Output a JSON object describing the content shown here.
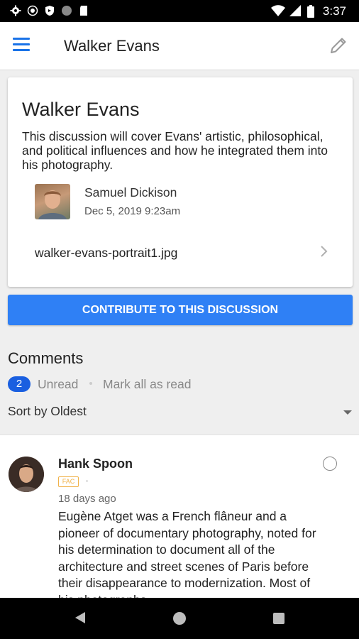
{
  "status_bar": {
    "time": "3:37",
    "icons": [
      "settings-icon",
      "aperture-icon",
      "shield-icon",
      "circle-icon",
      "sd-card-icon",
      "wifi-icon",
      "signal-icon",
      "battery-icon"
    ]
  },
  "app_bar": {
    "title": "Walker Evans",
    "menu_icon": "hamburger-menu-icon",
    "edit_icon": "pencil-icon"
  },
  "discussion": {
    "title": "Walker Evans",
    "description": "This discussion will cover Evans' artistic, philosophical, and political influences and how he integrated them into his photography.",
    "author": {
      "name": "Samuel Dickison",
      "date": "Dec 5, 2019 9:23am"
    },
    "attachment": {
      "filename": "walker-evans-portrait1.jpg"
    }
  },
  "contribute_button": "CONTRIBUTE TO THIS DISCUSSION",
  "comments": {
    "heading": "Comments",
    "unread_count": "2",
    "unread_label": "Unread",
    "mark_all_read": "Mark all as read",
    "sort_label": "Sort by Oldest",
    "items": [
      {
        "author": "Hank Spoon",
        "role_badge": "FAC",
        "time": "18 days ago",
        "body": "Eugène Atget was a French flâneur and a pioneer of documentary photography, noted for his determination to document all of the architecture and street scenes of Paris before their disappearance to modernization. Most of his photographs"
      }
    ]
  },
  "colors": {
    "primary": "#2f80f5",
    "badge": "#1a5fe0",
    "fac_badge": "#f0b24a",
    "menu_icon": "#1a73e8"
  }
}
